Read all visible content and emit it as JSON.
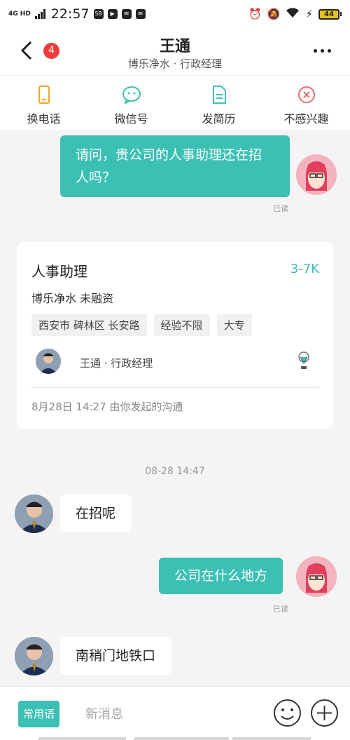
{
  "status_bar": {
    "network": "4G HD",
    "time": "22:57",
    "badge_icon_text": "58",
    "battery": "44"
  },
  "header": {
    "unread_count": "4",
    "name": "王通",
    "subtitle": "博乐净水 · 行政经理"
  },
  "toolbar": [
    {
      "label": "换电话",
      "icon": "phone-icon",
      "color": "#f5a623"
    },
    {
      "label": "微信号",
      "icon": "wechat-icon",
      "color": "#3cc0b4"
    },
    {
      "label": "发简历",
      "icon": "resume-icon",
      "color": "#3cc0b4"
    },
    {
      "label": "不感兴趣",
      "icon": "not-interested-icon",
      "color": "#f06a6a"
    }
  ],
  "messages": {
    "m1": {
      "text": "请问，贵公司的人事助理还在招人吗？",
      "read": "已读"
    },
    "m2": {
      "text": "在招呢"
    },
    "m3": {
      "text": "公司在什么地方",
      "read": "已读"
    },
    "m4": {
      "text": "南稍门地铁口"
    }
  },
  "job_card": {
    "title": "人事助理",
    "salary": "3-7K",
    "company": "博乐净水  未融资",
    "tags": [
      "西安市 碑林区 长安路",
      "经验不限",
      "大专"
    ],
    "recruiter": "王通 · 行政经理",
    "footer": "8月28日 14:27 由你发起的沟通"
  },
  "timestamp": "08-28 14:47",
  "input_bar": {
    "phrases_label": "常用语",
    "placeholder": "新消息"
  },
  "colors": {
    "accent": "#3cc0b4",
    "badge": "#f03c3c",
    "background": "#f4f4f4"
  }
}
